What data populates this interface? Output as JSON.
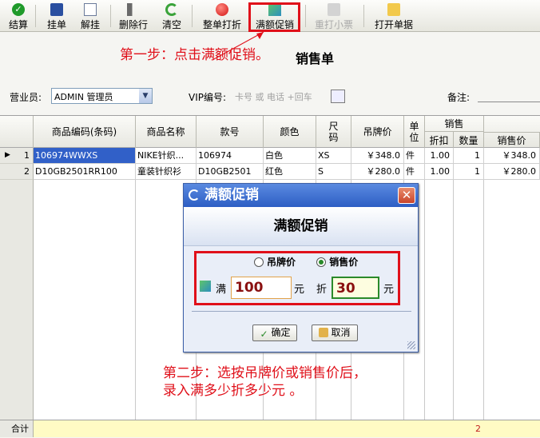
{
  "toolbar": {
    "buttons": [
      {
        "label": "结算"
      },
      {
        "label": "挂单"
      },
      {
        "label": "解挂"
      },
      {
        "label": "删除行"
      },
      {
        "label": "清空"
      },
      {
        "label": "整单打折"
      },
      {
        "label": "满额促销"
      },
      {
        "label": "重打小票"
      },
      {
        "label": "打开单据"
      }
    ]
  },
  "annotations": {
    "step1": "第一步：点击满额促销。",
    "step2_line1": "第二步：选按吊牌价或销售价后，",
    "step2_line2": "录入满多少折多少元 。"
  },
  "page_title": "销售单",
  "form": {
    "salesperson_label": "营业员:",
    "salesperson_value": "ADMIN 管理员",
    "vip_label": "VIP编号:",
    "vip_placeholder": "卡号 或 电话 +回车",
    "note_label": "备注:"
  },
  "grid": {
    "headers": {
      "code": "商品编码(条码)",
      "name": "商品名称",
      "style": "款号",
      "color": "颜色",
      "size": "尺码",
      "tag_price": "吊牌价",
      "unit": "单位",
      "sale_group": "销售",
      "discount": "折扣",
      "qty": "数量",
      "sale_price": "销售价"
    },
    "rows": [
      {
        "no": "1",
        "code": "106974WWXS",
        "name": "NIKE针织...",
        "style": "106974",
        "color": "白色",
        "size": "XS",
        "tag_price": "￥348.0",
        "unit": "件",
        "discount": "1.00",
        "qty": "1",
        "sale_price": "￥348.0"
      },
      {
        "no": "2",
        "code": "D10GB2501RR100",
        "name": "童装针织衫",
        "style": "D10GB2501",
        "color": "红色",
        "size": "S",
        "tag_price": "￥280.0",
        "unit": "件",
        "discount": "1.00",
        "qty": "1",
        "sale_price": "￥280.0"
      }
    ],
    "footer_label": "合计",
    "footer_qty": "2"
  },
  "dialog": {
    "title": "满额促销",
    "heading": "满额促销",
    "radio_tag": "吊牌价",
    "radio_sale": "销售价",
    "selected": "销售价",
    "full_label": "满",
    "full_value": "100",
    "yuan": "元",
    "discount_label": "折",
    "discount_value": "30",
    "ok": "确定",
    "cancel": "取消"
  },
  "colors": {
    "annotation": "#e0101a",
    "dialog_title": "#2d5ec4",
    "selection": "#3160c8"
  }
}
